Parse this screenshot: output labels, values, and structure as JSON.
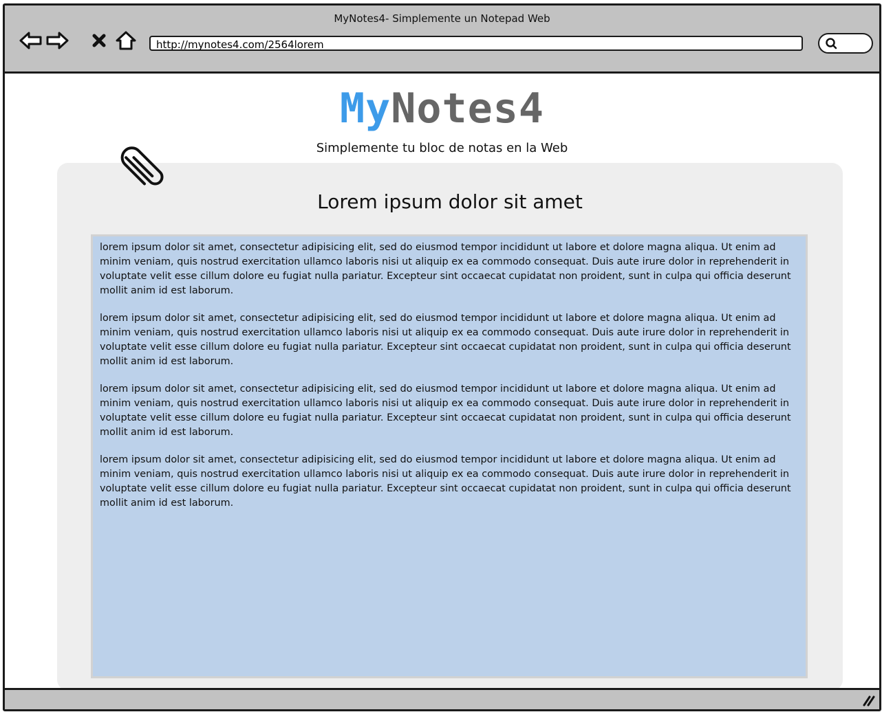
{
  "window": {
    "title": "MyNotes4- Simplemente un Notepad Web"
  },
  "toolbar": {
    "back_icon": "back-arrow-icon",
    "forward_icon": "forward-arrow-icon",
    "stop_icon": "close-icon",
    "home_icon": "home-icon",
    "address": "http://mynotes4.com/2564lorem",
    "search_icon": "search-icon"
  },
  "header": {
    "logo_part1": "My",
    "logo_part2": "Notes4",
    "tagline": "Simplemente tu bloc de notas en la Web",
    "logo_color_primary": "#3d9be9",
    "logo_color_secondary": "#666666"
  },
  "note": {
    "title": "Lorem ipsum dolor sit amet",
    "paragraphs": [
      "lorem ipsum dolor sit amet, consectetur adipisicing elit, sed do eiusmod tempor incididunt ut labore et dolore magna aliqua. Ut enim ad minim veniam, quis nostrud exercitation ullamco laboris nisi ut aliquip ex ea commodo consequat. Duis aute irure dolor in reprehenderit in voluptate velit esse cillum dolore eu fugiat nulla pariatur. Excepteur sint occaecat cupidatat non proident, sunt in culpa qui officia deserunt mollit anim id est laborum.",
      "lorem ipsum dolor sit amet, consectetur adipisicing elit, sed do eiusmod tempor incididunt ut labore et dolore magna aliqua. Ut enim ad minim veniam, quis nostrud exercitation ullamco laboris nisi ut aliquip ex ea commodo consequat. Duis aute irure dolor in reprehenderit in voluptate velit esse cillum dolore eu fugiat nulla pariatur. Excepteur sint occaecat cupidatat non proident, sunt in culpa qui officia deserunt mollit anim id est laborum.",
      "lorem ipsum dolor sit amet, consectetur adipisicing elit, sed do eiusmod tempor incididunt ut labore et dolore magna aliqua. Ut enim ad minim veniam, quis nostrud exercitation ullamco laboris nisi ut aliquip ex ea commodo consequat. Duis aute irure dolor in reprehenderit in voluptate velit esse cillum dolore eu fugiat nulla pariatur. Excepteur sint occaecat cupidatat non proident, sunt in culpa qui officia deserunt mollit anim id est laborum.",
      "lorem ipsum dolor sit amet, consectetur adipisicing elit, sed do eiusmod tempor incididunt ut labore et dolore magna aliqua. Ut enim ad minim veniam, quis nostrud exercitation ullamco laboris nisi ut aliquip ex ea commodo consequat. Duis aute irure dolor in reprehenderit in voluptate velit esse cillum dolore eu fugiat nulla pariatur. Excepteur sint occaecat cupidatat non proident, sunt in culpa qui officia deserunt mollit anim id est laborum."
    ],
    "background_color": "#bcd1ea",
    "paperclip_icon": "paperclip-icon"
  },
  "statusbar": {
    "resize_icon": "resize-grip-icon"
  }
}
